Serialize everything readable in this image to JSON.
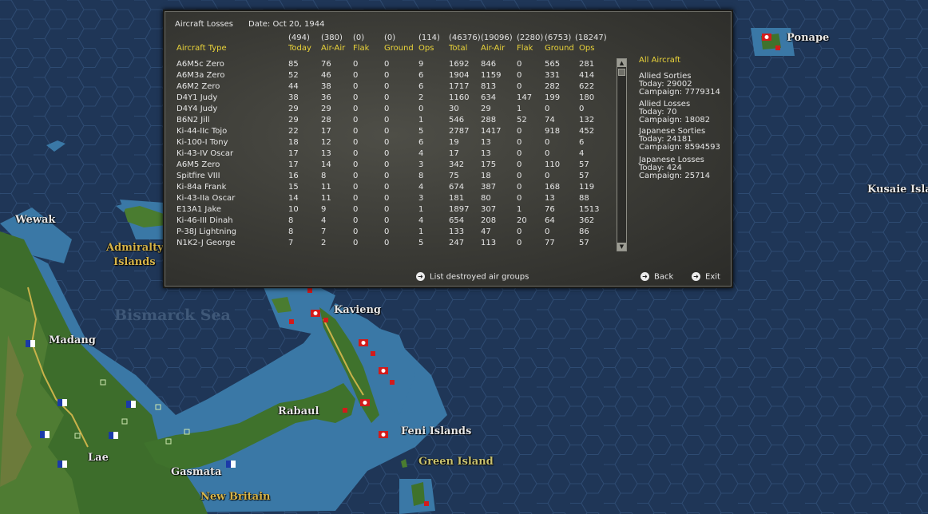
{
  "map": {
    "labels": {
      "ponape": "Ponape",
      "wewak": "Wewak",
      "admiralty_1": "Admiralty",
      "admiralty_2": "Islands",
      "kusaie": "Kusaie Islan",
      "bismarck": "Bismarck Sea",
      "kavieng": "Kavieng",
      "madang": "Madang",
      "rabaul": "Rabaul",
      "feni": "Feni Islands",
      "green": "Green Island",
      "lae": "Lae",
      "gasmata": "Gasmata",
      "new_britain": "New Britain"
    }
  },
  "panel": {
    "title": "Aircraft Losses",
    "date": "Date: Oct 20, 1944",
    "totals": [
      "(494)",
      "(380)",
      "(0)",
      "(0)",
      "(114)",
      "(46376)",
      "(19096)",
      "(2280)",
      "(6753)",
      "(18247)"
    ],
    "columns": [
      "Aircraft Type",
      "Today",
      "Air-Air",
      "Flak",
      "Ground",
      "Ops",
      "Total",
      "Air-Air",
      "Flak",
      "Ground",
      "Ops"
    ],
    "rows": [
      [
        "A6M5c Zero",
        "85",
        "76",
        "0",
        "0",
        "9",
        "1692",
        "846",
        "0",
        "565",
        "281"
      ],
      [
        "A6M3a Zero",
        "52",
        "46",
        "0",
        "0",
        "6",
        "1904",
        "1159",
        "0",
        "331",
        "414"
      ],
      [
        "A6M2 Zero",
        "44",
        "38",
        "0",
        "0",
        "6",
        "1717",
        "813",
        "0",
        "282",
        "622"
      ],
      [
        "D4Y1 Judy",
        "38",
        "36",
        "0",
        "0",
        "2",
        "1160",
        "634",
        "147",
        "199",
        "180"
      ],
      [
        "D4Y4 Judy",
        "29",
        "29",
        "0",
        "0",
        "0",
        "30",
        "29",
        "1",
        "0",
        "0"
      ],
      [
        "B6N2 Jill",
        "29",
        "28",
        "0",
        "0",
        "1",
        "546",
        "288",
        "52",
        "74",
        "132"
      ],
      [
        "Ki-44-IIc Tojo",
        "22",
        "17",
        "0",
        "0",
        "5",
        "2787",
        "1417",
        "0",
        "918",
        "452"
      ],
      [
        "Ki-100-I Tony",
        "18",
        "12",
        "0",
        "0",
        "6",
        "19",
        "13",
        "0",
        "0",
        "6"
      ],
      [
        "Ki-43-IV Oscar",
        "17",
        "13",
        "0",
        "0",
        "4",
        "17",
        "13",
        "0",
        "0",
        "4"
      ],
      [
        "A6M5 Zero",
        "17",
        "14",
        "0",
        "0",
        "3",
        "342",
        "175",
        "0",
        "110",
        "57"
      ],
      [
        "Spitfire VIII",
        "16",
        "8",
        "0",
        "0",
        "8",
        "75",
        "18",
        "0",
        "0",
        "57"
      ],
      [
        "Ki-84a Frank",
        "15",
        "11",
        "0",
        "0",
        "4",
        "674",
        "387",
        "0",
        "168",
        "119"
      ],
      [
        "Ki-43-IIa Oscar",
        "14",
        "11",
        "0",
        "0",
        "3",
        "181",
        "80",
        "0",
        "13",
        "88"
      ],
      [
        "E13A1 Jake",
        "10",
        "9",
        "0",
        "0",
        "1",
        "1897",
        "307",
        "1",
        "76",
        "1513"
      ],
      [
        "Ki-46-III Dinah",
        "8",
        "4",
        "0",
        "0",
        "4",
        "654",
        "208",
        "20",
        "64",
        "362"
      ],
      [
        "P-38J Lightning",
        "8",
        "7",
        "0",
        "0",
        "1",
        "133",
        "47",
        "0",
        "0",
        "86"
      ],
      [
        "N1K2-J George",
        "7",
        "2",
        "0",
        "0",
        "5",
        "247",
        "113",
        "0",
        "77",
        "57"
      ]
    ],
    "side": {
      "header": "All Aircraft",
      "groups": [
        {
          "title": "Allied Sorties",
          "today": "Today:  29002",
          "campaign": "Campaign: 7779314"
        },
        {
          "title": "Allied Losses",
          "today": "Today:  70",
          "campaign": "Campaign: 18082"
        },
        {
          "title": "Japanese Sorties",
          "today": "Today:  24181",
          "campaign": "Campaign: 8594593"
        },
        {
          "title": "Japanese Losses",
          "today": "Today:  424",
          "campaign": "Campaign: 25714"
        }
      ]
    },
    "buttons": {
      "list_destroyed": "List destroyed air groups",
      "back": "Back",
      "exit": "Exit"
    }
  },
  "colors": {
    "ocean": "#1f3657",
    "hex_line": "#2c4a70",
    "shallow": "#3f7dab",
    "land": "#3a6b2a",
    "header_yellow": "#e9d33a",
    "jp_flag_red": "#d21b1b"
  }
}
